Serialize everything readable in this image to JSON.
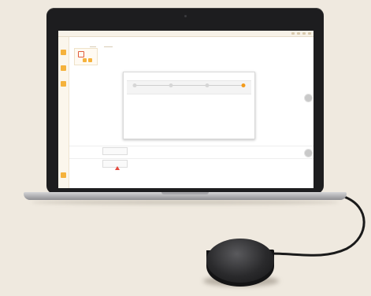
{
  "scene": {
    "description_colors": {
      "background": "#efe9df",
      "laptop_bezel": "#1d1d1f",
      "accent_orange": "#f39b1b",
      "warning_red": "#e4483c"
    }
  },
  "icons": [
    "camera-icon",
    "warning-icon"
  ]
}
